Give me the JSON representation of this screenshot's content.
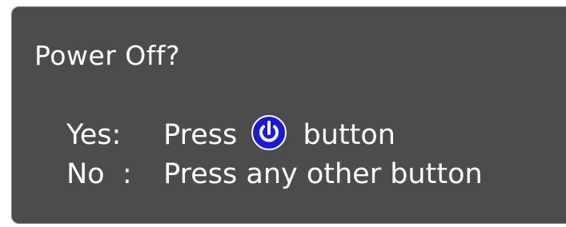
{
  "dialog": {
    "title": "Power Off?",
    "yes": {
      "label": "Yes:",
      "prefix": "Press",
      "icon": "power-icon",
      "suffix": "button"
    },
    "no": {
      "label": "No  :",
      "text": "Press any other button"
    }
  },
  "colors": {
    "panel": "#4c4c4c",
    "text": "#ffffff",
    "power_icon": "#1b1bd6"
  }
}
